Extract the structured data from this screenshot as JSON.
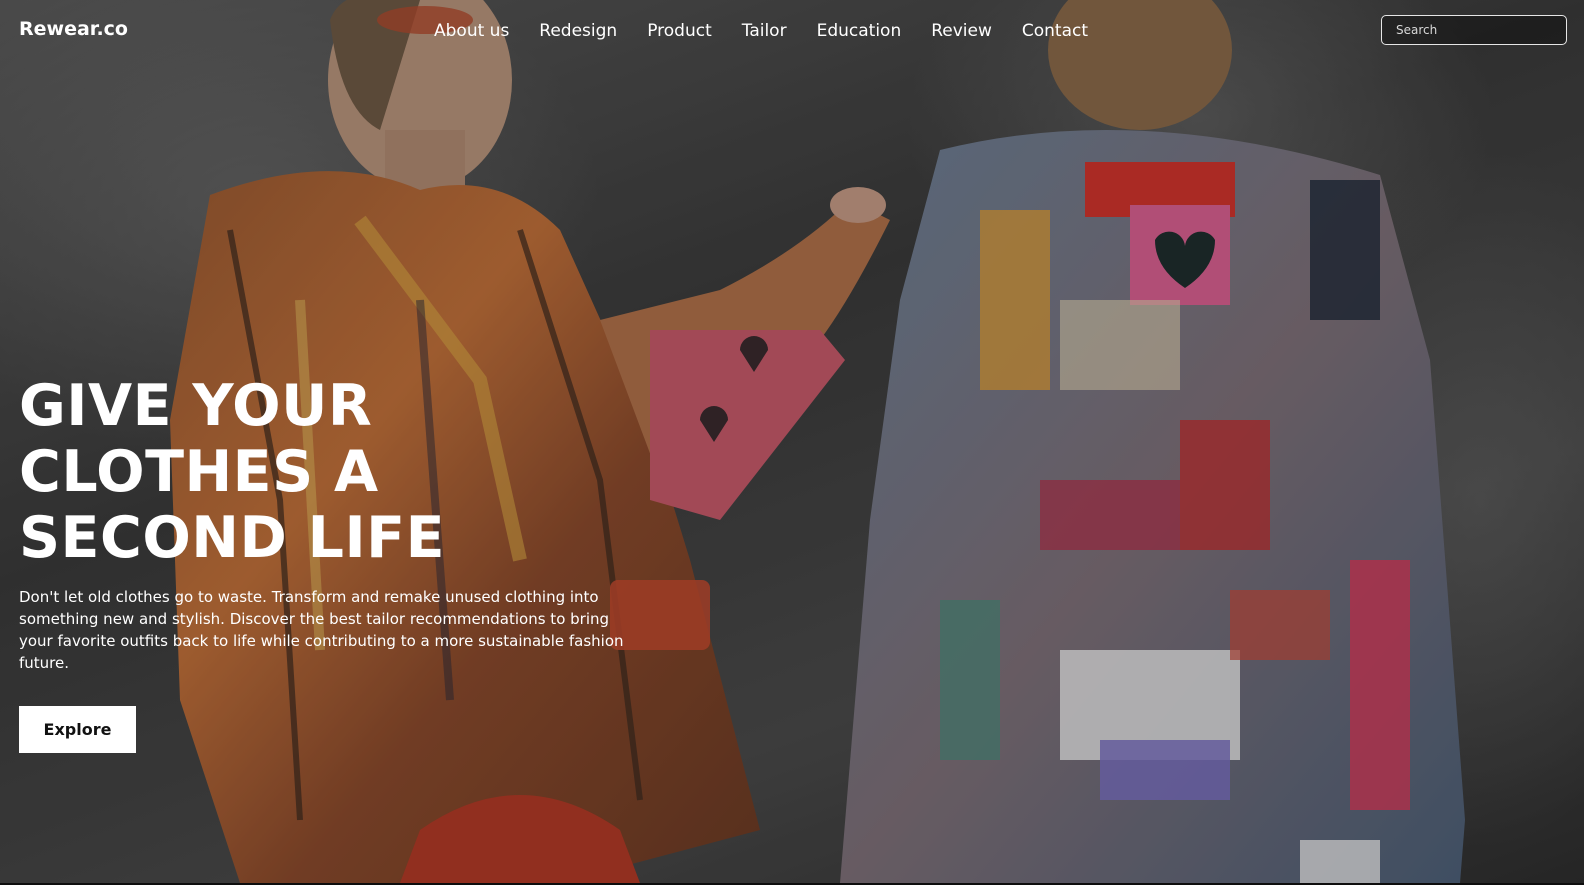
{
  "brand": {
    "name": "Rewear.co"
  },
  "nav": {
    "items": [
      {
        "label": "About us"
      },
      {
        "label": "Redesign"
      },
      {
        "label": "Product"
      },
      {
        "label": "Tailor"
      },
      {
        "label": "Education"
      },
      {
        "label": "Review"
      },
      {
        "label": "Contact"
      }
    ]
  },
  "search": {
    "placeholder": "Search",
    "value": ""
  },
  "hero": {
    "headline_lines": [
      "GIVE YOUR",
      "CLOTHES A",
      "SECOND LIFE"
    ],
    "description": "Don't let old clothes go to waste. Transform and remake unused clothing into something new and stylish. Discover the best tailor recommendations to bring your favorite outfits back to life while contributing to a more sustainable fashion future.",
    "cta_label": "Explore"
  },
  "colors": {
    "text": "#ffffff",
    "button_bg": "#ffffff",
    "button_text": "#111111",
    "background": "#3c3c3c"
  }
}
